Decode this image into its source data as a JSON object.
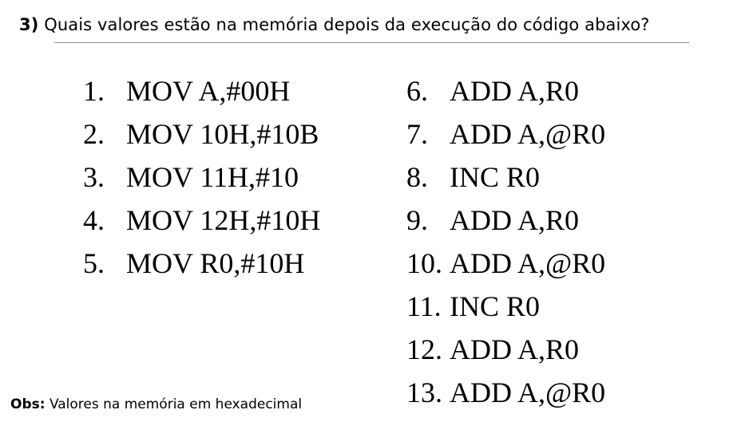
{
  "question": {
    "number": "3)",
    "text": " Quais valores estão na memória depois da execução do código abaixo?"
  },
  "code": {
    "left_column": [
      {
        "num": "1.",
        "instr": "MOV A,#00H"
      },
      {
        "num": "2.",
        "instr": "MOV 10H,#10B"
      },
      {
        "num": "3.",
        "instr": "MOV 11H,#10"
      },
      {
        "num": "4.",
        "instr": "MOV 12H,#10H"
      },
      {
        "num": "5.",
        "instr": "MOV R0,#10H"
      }
    ],
    "right_column": [
      {
        "num": "6.",
        "instr": "ADD A,R0"
      },
      {
        "num": "7.",
        "instr": "ADD A,@R0"
      },
      {
        "num": "8.",
        "instr": "INC R0"
      },
      {
        "num": "9.",
        "instr": "ADD A,R0"
      },
      {
        "num": "10.",
        "instr": "ADD A,@R0"
      },
      {
        "num": "11.",
        "instr": "INC R0"
      },
      {
        "num": "12.",
        "instr": "ADD A,R0"
      },
      {
        "num": "13.",
        "instr": "ADD A,@R0"
      }
    ]
  },
  "note": {
    "label": "Obs:",
    "text": " Valores na memória em hexadecimal"
  }
}
